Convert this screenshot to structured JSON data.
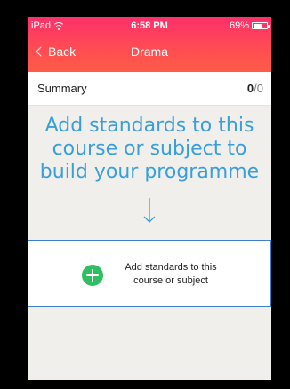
{
  "status_bar": {
    "carrier": "iPad",
    "time": "6:58 PM",
    "battery_percent_text": "69%",
    "battery_level": 0.69
  },
  "nav": {
    "back_label": "Back",
    "title": "Drama"
  },
  "summary": {
    "label": "Summary",
    "completed": "0",
    "total": "/0"
  },
  "prompt": {
    "line1": "Add standards to this",
    "line2": "course or subject to",
    "line3": "build your programme"
  },
  "add_box": {
    "line1": "Add standards to this",
    "line2": "course or subject"
  },
  "colors": {
    "header_top": "#ff2f6b",
    "header_bottom": "#ff5c47",
    "prompt_blue": "#3a9fd8",
    "add_green": "#2fbf62",
    "box_border": "#3a7fd0"
  },
  "icons": {
    "wifi": "wifi-icon",
    "battery": "battery-icon",
    "back": "chevron-left-icon",
    "arrow": "arrow-down-icon",
    "add": "plus-circle-icon"
  }
}
